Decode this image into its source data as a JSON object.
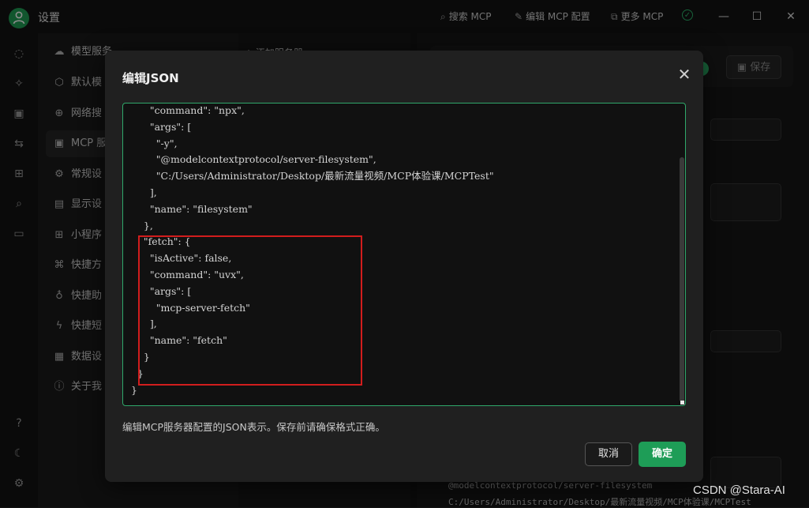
{
  "window": {
    "title": "设置",
    "actions": [
      {
        "glyph": "⌕",
        "label": "搜索 MCP"
      },
      {
        "glyph": "✎",
        "label": "编辑 MCP 配置"
      },
      {
        "glyph": "⧉",
        "label": "更多 MCP"
      }
    ],
    "status_check": "✓",
    "controls": {
      "minimize": "—",
      "maximize": "☐",
      "close": "✕"
    }
  },
  "rail_icons": [
    "chat-icon",
    "sparkle-icon",
    "image-icon",
    "translate-icon",
    "apps-icon",
    "files-search-icon",
    "folder-icon",
    "help-icon",
    "moon-icon",
    "gear-icon"
  ],
  "rail_glyphs": [
    "◌",
    "✧",
    "▣",
    "⇆",
    "⊞",
    "⌕",
    "▭",
    "?",
    "☾",
    "⚙"
  ],
  "settings_nav": {
    "items": [
      {
        "icon": "☁",
        "label": "模型服务"
      },
      {
        "icon": "⬡",
        "label": "默认模"
      },
      {
        "icon": "⊕",
        "label": "网络搜"
      },
      {
        "icon": "▣",
        "label": "MCP 服"
      },
      {
        "icon": "⚙",
        "label": "常规设"
      },
      {
        "icon": "▤",
        "label": "显示设"
      },
      {
        "icon": "⊞",
        "label": "小程序"
      },
      {
        "icon": "⌘",
        "label": "快捷方"
      },
      {
        "icon": "♁",
        "label": "快捷助"
      },
      {
        "icon": "ϟ",
        "label": "快捷短"
      },
      {
        "icon": "▦",
        "label": "数据设"
      },
      {
        "icon": "ⓘ",
        "label": "关于我"
      }
    ]
  },
  "mid": {
    "add_label": "+ 添加服务器"
  },
  "right": {
    "save_label": "保存",
    "save_glyph": "▣",
    "bottom_code": [
      "@modelcontextprotocol/server-filesystem",
      "C:/Users/Administrator/Desktop/最新流量视频/MCP体验课/MCPTest"
    ]
  },
  "modal": {
    "title": "编辑JSON",
    "close_glyph": "✕",
    "code_lines": [
      "      \"command\": \"npx\",",
      "      \"args\": [",
      "        \"-y\",",
      "        \"@modelcontextprotocol/server-filesystem\",",
      "        \"C:/Users/Administrator/Desktop/最新流量视频/MCP体验课/MCPTest\"",
      "      ],",
      "      \"name\": \"filesystem\"",
      "    },",
      "    \"fetch\": {",
      "      \"isActive\": false,",
      "      \"command\": \"uvx\",",
      "      \"args\": [",
      "        \"mcp-server-fetch\"",
      "      ],",
      "      \"name\": \"fetch\"",
      "    }",
      "  }",
      "}"
    ],
    "help_text": "编辑MCP服务器配置的JSON表示。保存前请确保格式正确。",
    "cancel_label": "取消",
    "ok_label": "确定"
  },
  "watermark": "CSDN @Stara-AI",
  "colors": {
    "accent": "#1e9d57",
    "highlight": "#d21d1d",
    "editor_border": "#2fa86a"
  }
}
